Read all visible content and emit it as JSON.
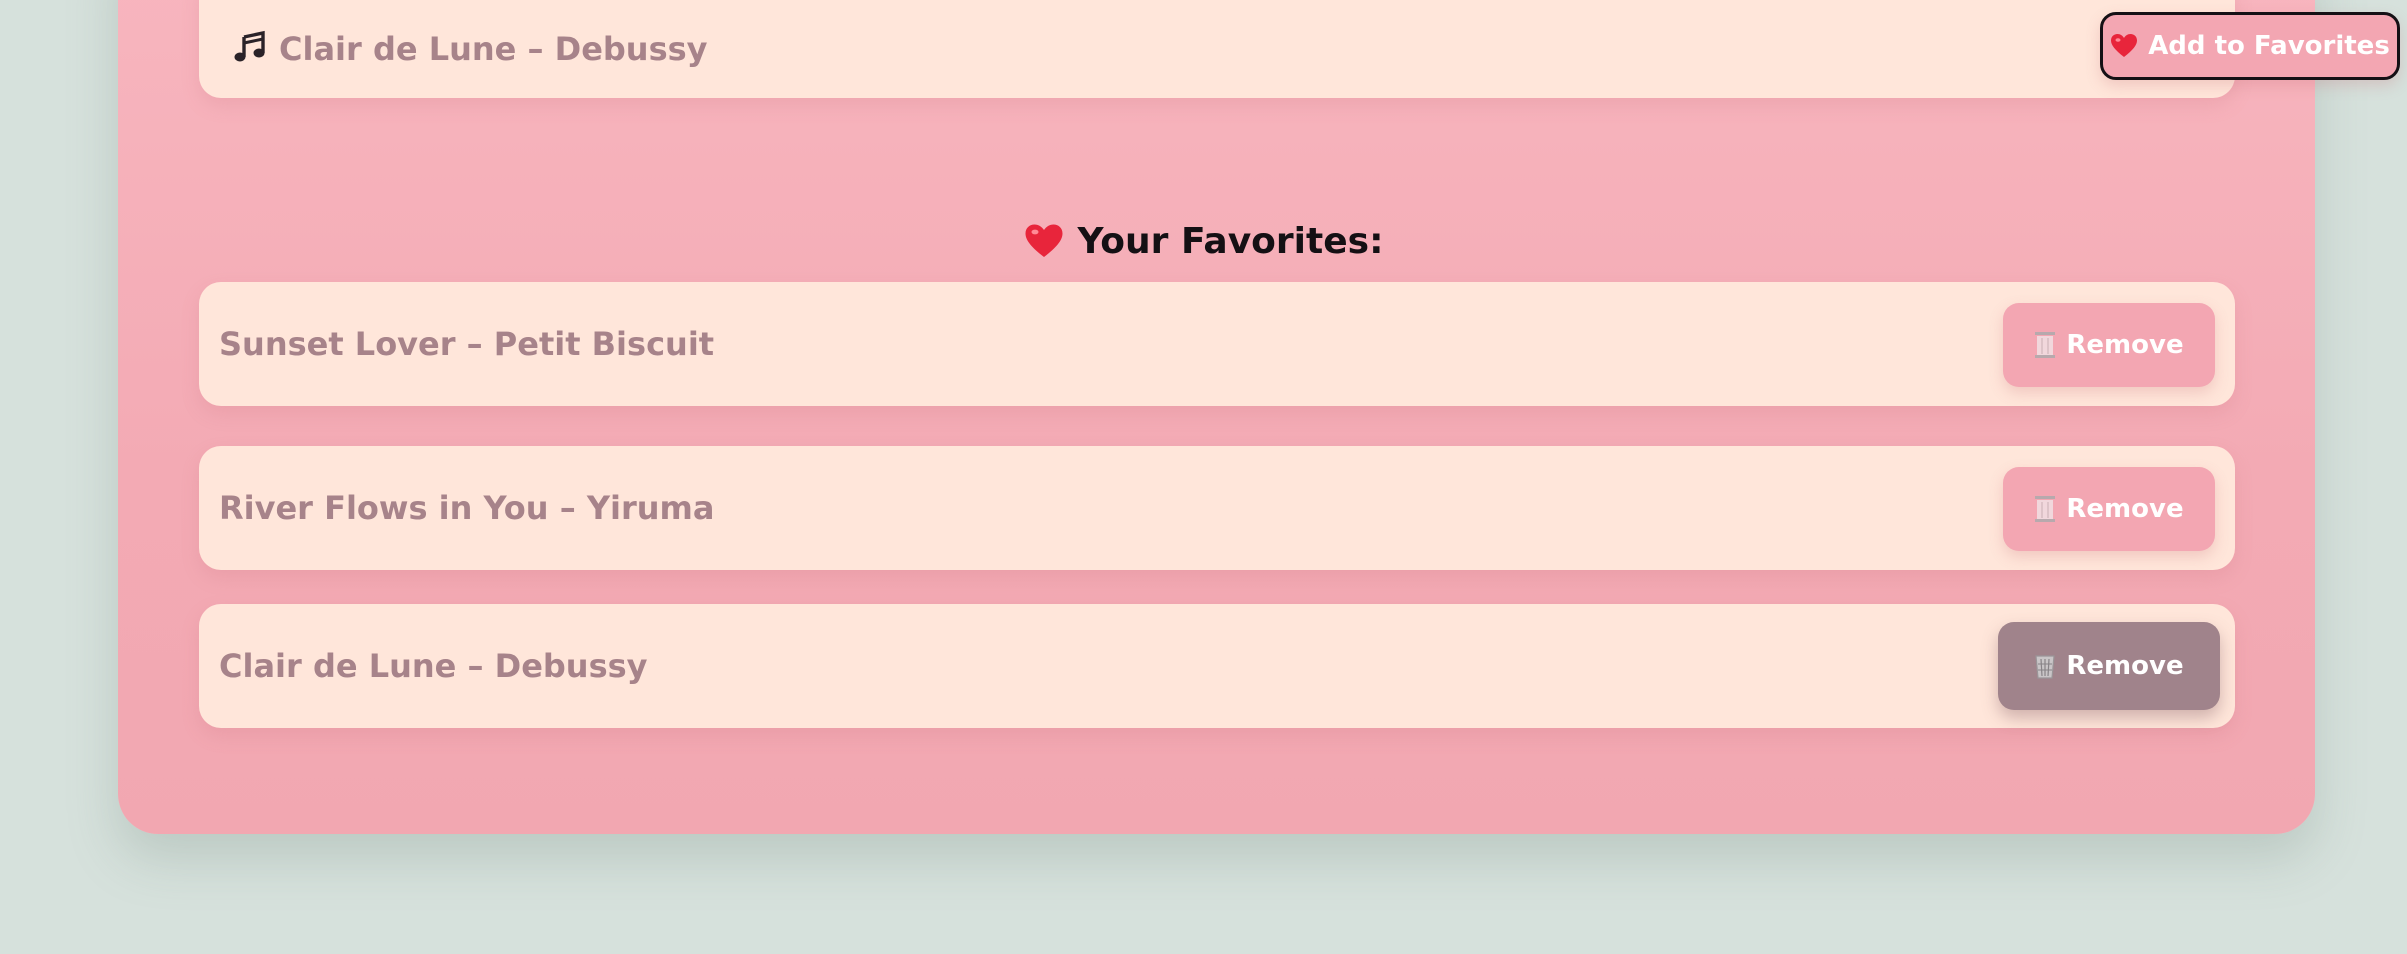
{
  "now_playing": {
    "icon": "music-notes-icon",
    "song": "Clair de Lune – Debussy",
    "add_button_icon": "heart-icon",
    "add_button_label": "Add to Favorites"
  },
  "favorites": {
    "title_icon": "heart-icon",
    "title": "Your Favorites:",
    "remove_icon": "trash-icon",
    "items": [
      {
        "song": "Sunset Lover – Petit Biscuit",
        "remove_label": "Remove"
      },
      {
        "song": "River Flows in You – Yiruma",
        "remove_label": "Remove"
      },
      {
        "song": "Clair de Lune – Debussy",
        "remove_label": "Remove"
      }
    ]
  },
  "colors": {
    "background": "#d6e1dc",
    "card": "#f5b0ba",
    "row": "#ffe6da",
    "button": "#f3a6b2",
    "button_hover": "#a0838b",
    "heart": "#e8253b",
    "text_muted": "#a7838a",
    "text_dark": "#141014"
  }
}
